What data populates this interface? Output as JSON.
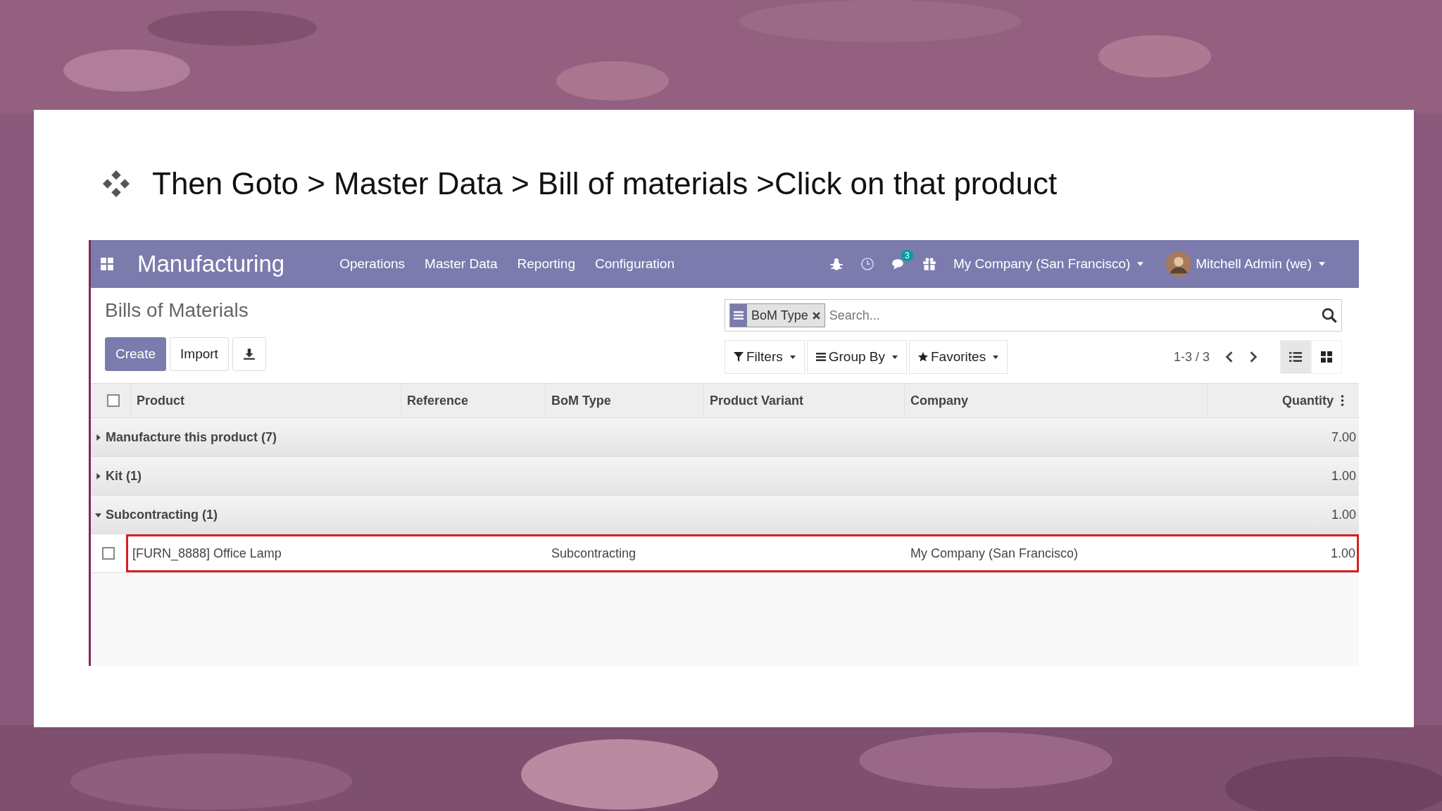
{
  "slide": {
    "bullet_text": "Then Goto > Master Data > Bill of materials >Click on that product"
  },
  "navbar": {
    "app_name": "Manufacturing",
    "menu": [
      "Operations",
      "Master Data",
      "Reporting",
      "Configuration"
    ],
    "messages_badge": "3",
    "company": "My Company (San Francisco)",
    "user": "Mitchell Admin (we)"
  },
  "control_panel": {
    "breadcrumb": "Bills of Materials",
    "buttons": [
      "Create",
      "Import"
    ],
    "search": {
      "facet": "BoM Type",
      "placeholder": "Search..."
    },
    "filters": [
      "Filters",
      "Group By",
      "Favorites"
    ],
    "pager": "1-3 / 3",
    "views": [
      {
        "kind": "list",
        "selected": true
      },
      {
        "kind": "kanban",
        "selected": false
      }
    ]
  },
  "table": {
    "select_all_checked": false,
    "columns": [
      "Product",
      "Reference",
      "BoM Type",
      "Product Variant",
      "Company",
      "Quantity"
    ],
    "groups": [
      {
        "label": "Manufacture this product (7)",
        "expanded": false,
        "quantity": "7.00"
      },
      {
        "label": "Kit (1)",
        "expanded": false,
        "quantity": "1.00"
      },
      {
        "label": "Subcontracting (1)",
        "expanded": true,
        "quantity": "1.00",
        "rows": [
          {
            "product": "[FURN_8888] Office Lamp",
            "bom_type": "Subcontracting",
            "company": "My Company (San Francisco)",
            "quantity": "1.00",
            "checked": false,
            "highlighted": true
          }
        ]
      }
    ]
  }
}
